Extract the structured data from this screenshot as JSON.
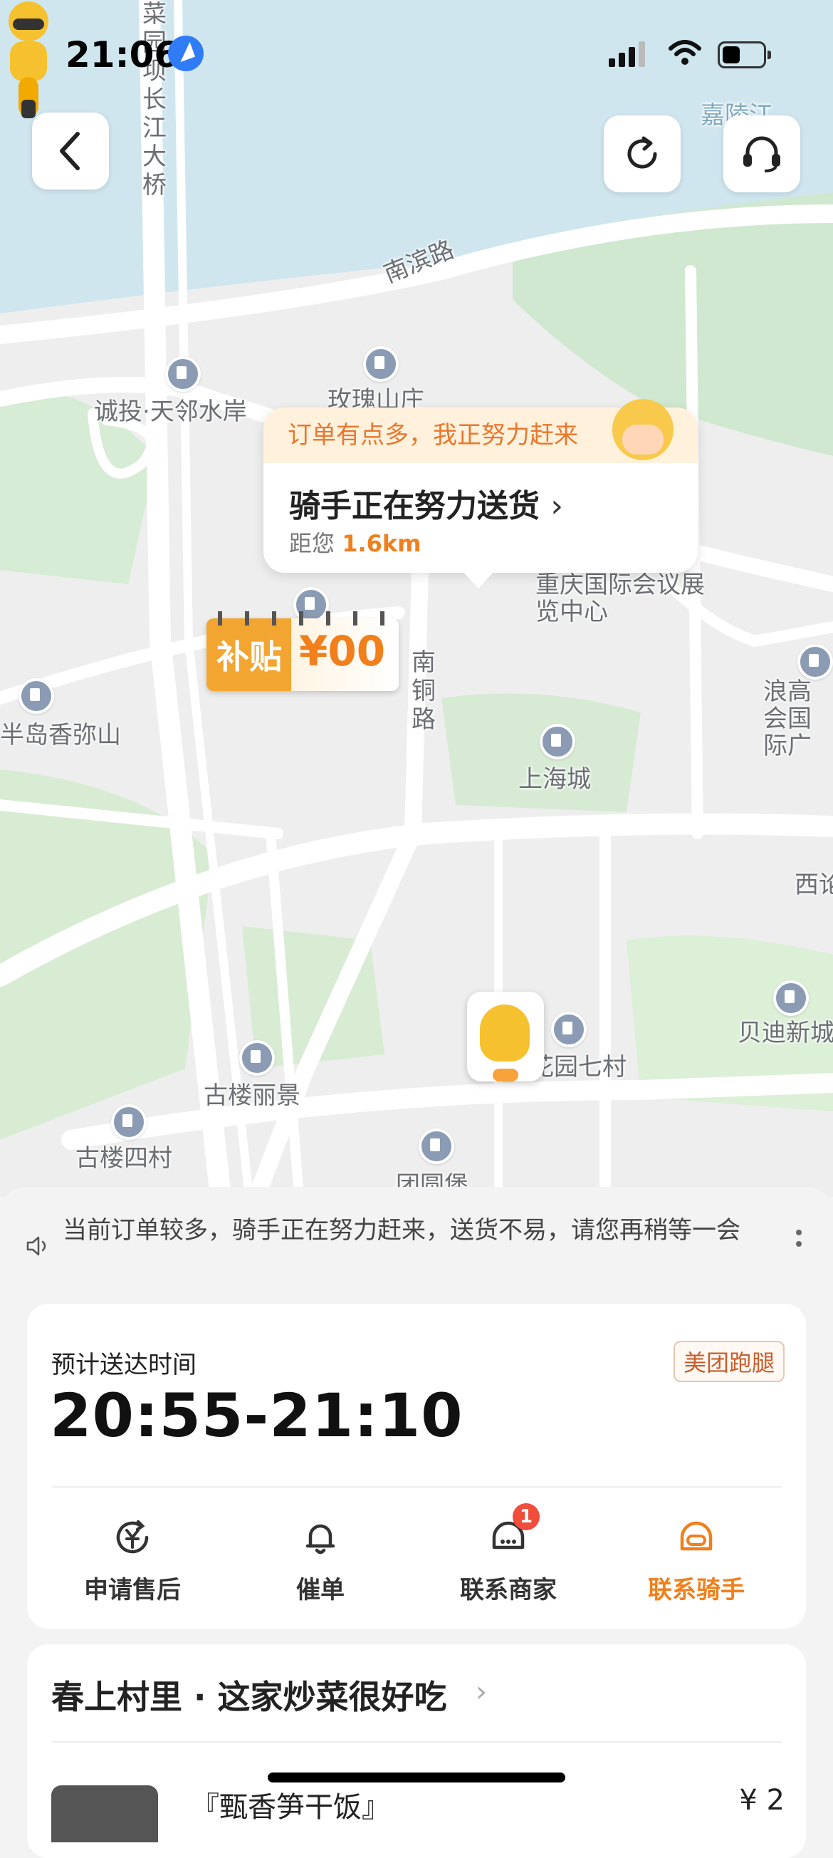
{
  "status": {
    "time": "21:06"
  },
  "map": {
    "labels": {
      "bridge": "菜园坝长江大桥",
      "river": "嘉陵江",
      "road_nanbin": "南滨路",
      "rose": "玫瑰山庄",
      "chengtou": "诚投·天邻水岸",
      "expo": "重庆国际会议展览中心",
      "peninsula": "半岛香弥山",
      "nantong": "南铜路",
      "shanghai": "上海城",
      "langgao": "浪高会国际广",
      "xi": "西论",
      "beidi": "贝迪新城",
      "garden": "花园七村",
      "gulou_lijing": "古楼丽景",
      "gulou_sicun": "古楼四村",
      "tuanyuan": "团圆堡"
    }
  },
  "bubble": {
    "banner": "订单有点多，我正努力赶来",
    "title": "骑手正在努力送货",
    "distance_prefix": "距您",
    "distance": "1.6km"
  },
  "subsidy": {
    "label": "补贴",
    "amount": "¥00"
  },
  "notice": {
    "text": "当前订单较多，骑手正在努力赶来，送货不易，请您再稍等一会"
  },
  "delivery": {
    "eta_label": "预计送达时间",
    "eta": "20:55-21:10",
    "brand": "美团跑腿",
    "actions": [
      {
        "label": "申请售后"
      },
      {
        "label": "催单"
      },
      {
        "label": "联系商家",
        "badge": "1"
      },
      {
        "label": "联系骑手"
      }
    ]
  },
  "shop": {
    "name": "春上村里 · 这家炒菜很好吃",
    "item_name": "『甄香笋干饭』",
    "item_price": "¥ 2"
  },
  "colors": {
    "accent": "#f07f1c",
    "river": "#cfe6ef",
    "park": "#c8e6c9"
  }
}
